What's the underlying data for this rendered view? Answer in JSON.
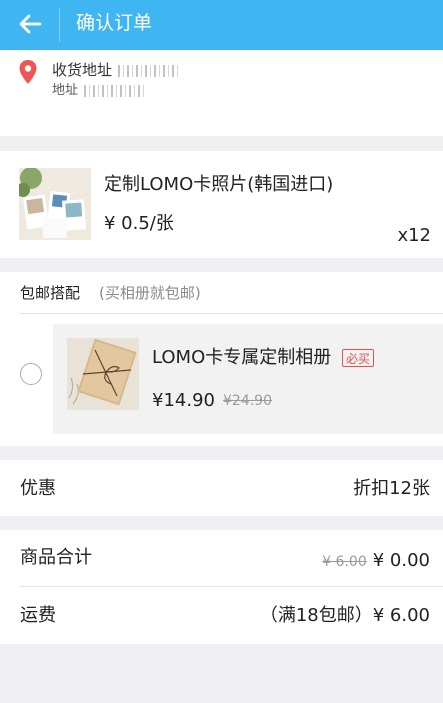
{
  "header": {
    "title": "确认订单"
  },
  "address": {
    "line1": "收货地址",
    "line2": "地址"
  },
  "product": {
    "name": "定制LOMO卡照片(韩国进口)",
    "price": "¥ 0.5/张",
    "quantity": "x12"
  },
  "package": {
    "title": "包邮搭配",
    "note": "(买相册就包邮)",
    "item": {
      "name": "LOMO卡专属定制相册",
      "tag": "必买",
      "price": "¥14.90",
      "original_price": "¥24.90"
    }
  },
  "discount": {
    "label": "优惠",
    "value": "折扣12张"
  },
  "subtotal": {
    "label": "商品合计",
    "original": "¥ 6.00",
    "value": "¥ 0.00"
  },
  "shipping": {
    "label": "运费",
    "value": "（满18包邮）¥ 6.00"
  },
  "colors": {
    "header": "#3fb6f1",
    "pin": "#f05555",
    "tag": "#e05252",
    "background": "#efeff4"
  }
}
